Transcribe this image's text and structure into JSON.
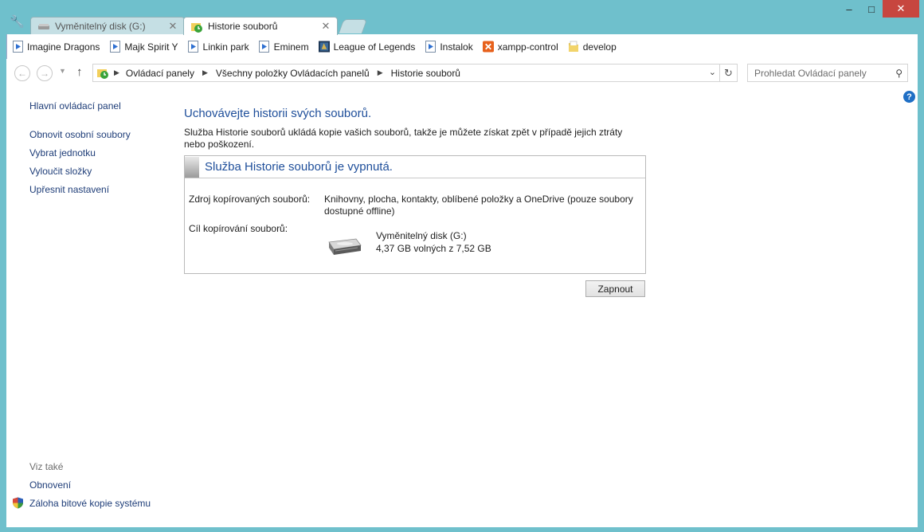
{
  "tabs": [
    {
      "label": "Vyměnitelný disk (G:)",
      "active": false
    },
    {
      "label": "Historie souborů",
      "active": true
    }
  ],
  "window_buttons": {
    "minimize": "–",
    "maximize": "□",
    "close": "✕"
  },
  "bookmarks": [
    {
      "label": "Imagine Dragons",
      "icon": "video-icon"
    },
    {
      "label": "Majk Spirit Y",
      "icon": "video-icon"
    },
    {
      "label": "Linkin park",
      "icon": "video-icon"
    },
    {
      "label": "Eminem",
      "icon": "video-icon"
    },
    {
      "label": "League of Legends",
      "icon": "app-icon"
    },
    {
      "label": "Instalok",
      "icon": "video-icon"
    },
    {
      "label": "xampp-control",
      "icon": "xampp-icon"
    },
    {
      "label": "develop",
      "icon": "folder-icon"
    }
  ],
  "address": {
    "crumbs": [
      "Ovládací panely",
      "Všechny položky Ovládacích panelů",
      "Historie souborů"
    ]
  },
  "search": {
    "placeholder": "Prohledat Ovládací panely"
  },
  "left_panel": {
    "home": "Hlavní ovládací panel",
    "links": [
      "Obnovit osobní soubory",
      "Vybrat jednotku",
      "Vyloučit složky",
      "Upřesnit nastavení"
    ],
    "see_also_label": "Viz také",
    "see_also": [
      "Obnovení",
      "Záloha bitové kopie systému"
    ]
  },
  "main": {
    "title": "Uchovávejte historii svých souborů.",
    "description": "Služba Historie souborů ukládá kopie vašich souborů, takže je můžete získat zpět v případě jejich ztráty nebo poškození.",
    "status_title": "Služba Historie souborů je vypnutá.",
    "source_label": "Zdroj kopírovaných souborů:",
    "source_value": "Knihovny, plocha, kontakty, oblíbené položky a OneDrive (pouze soubory dostupné offline)",
    "target_label": "Cíl kopírování souborů:",
    "drive_name": "Vyměnitelný disk (G:)",
    "drive_free": "4,37 GB volných z 7,52 GB",
    "turn_on_button": "Zapnout"
  },
  "colors": {
    "frame": "#6fc0cc",
    "link": "#1e3d78",
    "heading": "#1e4e9a",
    "close_button": "#c7463f"
  }
}
